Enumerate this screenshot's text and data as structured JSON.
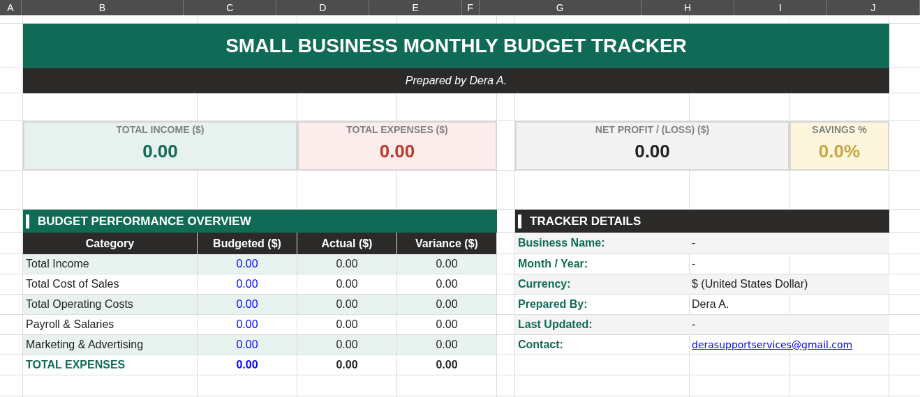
{
  "column_headers": [
    "A",
    "B",
    "C",
    "D",
    "E",
    "F",
    "G",
    "H",
    "I",
    "J"
  ],
  "title": "SMALL BUSINESS MONTHLY BUDGET TRACKER",
  "subtitle": "Prepared by Dera A.",
  "kpis": [
    {
      "kind": "income",
      "label": "TOTAL INCOME ($)",
      "value": "0.00"
    },
    {
      "kind": "expenses",
      "label": "TOTAL EXPENSES ($)",
      "value": "0.00"
    },
    {
      "kind": "profit",
      "label": "NET PROFIT / (LOSS) ($)",
      "value": "0.00"
    },
    {
      "kind": "savings",
      "label": "SAVINGS %",
      "value": "0.0%"
    }
  ],
  "overview": {
    "title": "BUDGET PERFORMANCE OVERVIEW",
    "columns": [
      "Category",
      "Budgeted ($)",
      "Actual ($)",
      "Variance ($)"
    ],
    "rows": [
      {
        "category": "Total Income",
        "budgeted": "0.00",
        "actual": "0.00",
        "variance": "0.00"
      },
      {
        "category": "Total Cost of Sales",
        "budgeted": "0.00",
        "actual": "0.00",
        "variance": "0.00"
      },
      {
        "category": "Total Operating Costs",
        "budgeted": "0.00",
        "actual": "0.00",
        "variance": "0.00"
      },
      {
        "category": "Payroll & Salaries",
        "budgeted": "0.00",
        "actual": "0.00",
        "variance": "0.00"
      },
      {
        "category": "Marketing & Advertising",
        "budgeted": "0.00",
        "actual": "0.00",
        "variance": "0.00"
      }
    ],
    "total": {
      "category": "TOTAL EXPENSES",
      "budgeted": "0.00",
      "actual": "0.00",
      "variance": "0.00"
    }
  },
  "tracker": {
    "title": "TRACKER DETAILS",
    "fields": [
      {
        "kind": "text",
        "label": "Business Name:",
        "value": "-"
      },
      {
        "kind": "text",
        "label": "Month / Year:",
        "value": "-"
      },
      {
        "kind": "text",
        "label": "Currency:",
        "value": "$ (United States Dollar)"
      },
      {
        "kind": "text",
        "label": "Prepared By:",
        "value": "Dera A."
      },
      {
        "kind": "text",
        "label": "Last Updated:",
        "value": "-"
      },
      {
        "kind": "link",
        "label": "Contact:",
        "value": "derasupportservices@gmail.com"
      }
    ]
  }
}
